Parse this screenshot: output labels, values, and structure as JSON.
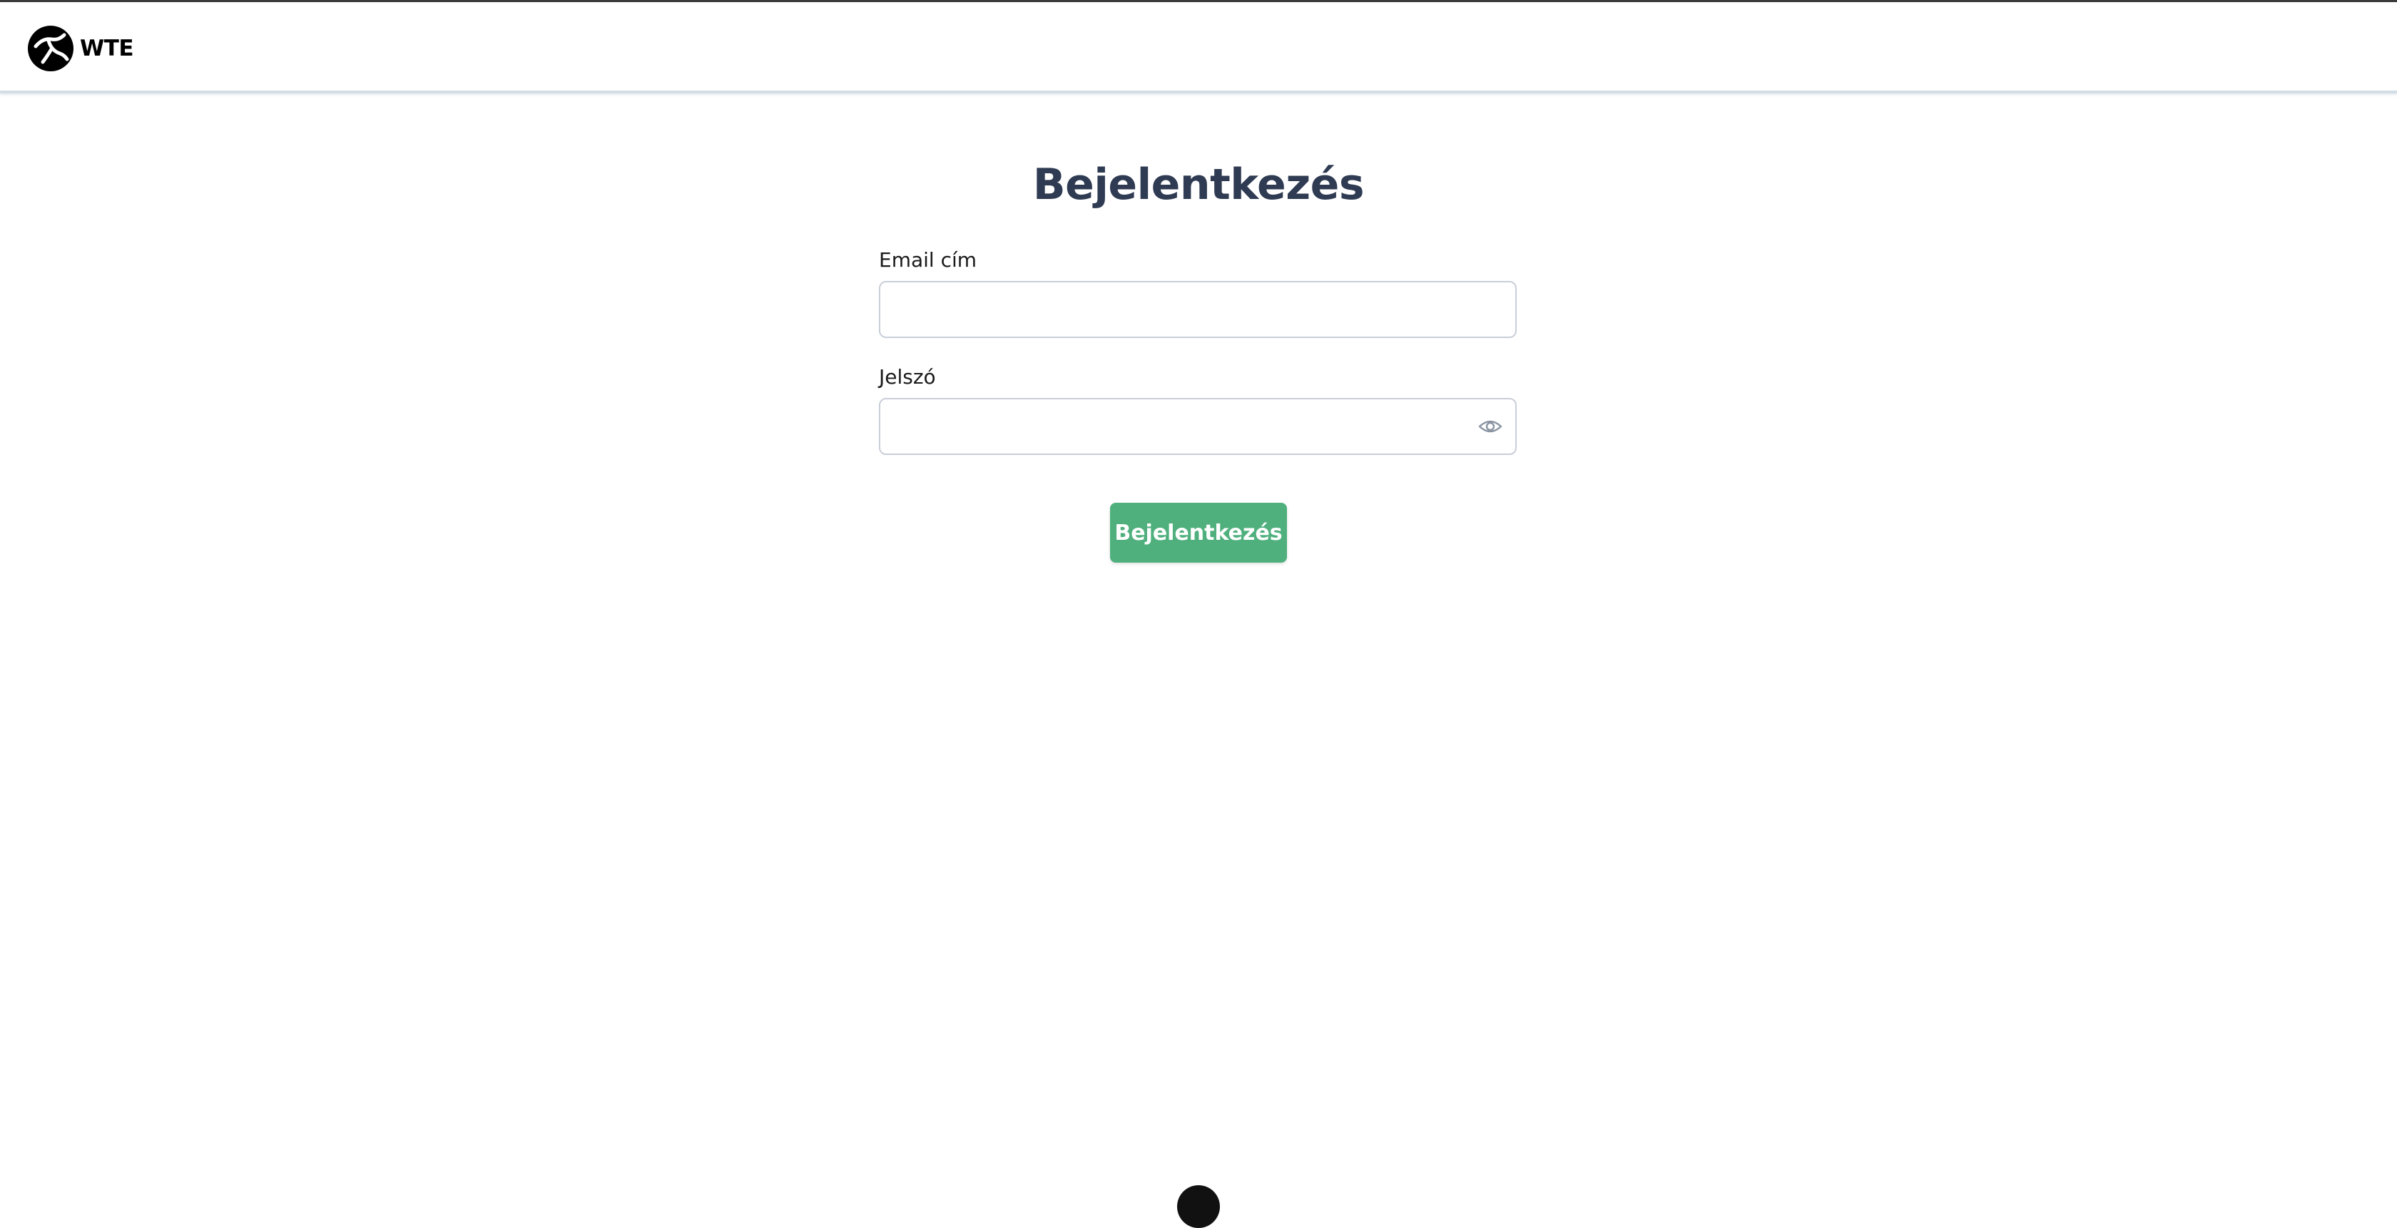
{
  "header": {
    "brand": "WTE",
    "logo_icon": "wte-logo-icon"
  },
  "login": {
    "title": "Bejelentkezés",
    "email_label": "Email cím",
    "email_value": "",
    "email_placeholder": "",
    "password_label": "Jelszó",
    "password_value": "",
    "password_placeholder": "",
    "password_toggle_icon": "eye-icon",
    "submit_label": "Bejelentkezés"
  },
  "colors": {
    "title": "#2f3b52",
    "primary_button": "#4fb07e",
    "input_border": "#c8ced8",
    "header_border": "#d3dde6"
  }
}
